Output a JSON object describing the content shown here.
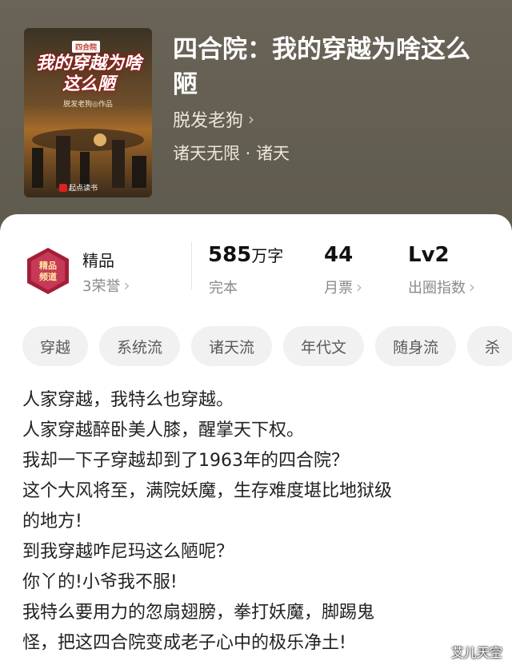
{
  "book": {
    "title": "四合院：我的穿越为啥这么陋",
    "author": "脱发老狗",
    "category": "诸天无限 · 诸天"
  },
  "cover": {
    "tag": "四合院",
    "title": "我的穿越为啥这么陋",
    "author_line": "脱发老狗◎作品",
    "publisher": "起点读书"
  },
  "stats": {
    "quality": {
      "label": "精品",
      "sub": "3荣誉"
    },
    "badge_text": "精品频道",
    "words": {
      "value": "585",
      "unit": "万字",
      "sub": "完本"
    },
    "votes": {
      "value": "44",
      "sub": "月票"
    },
    "level": {
      "value": "Lv2",
      "sub": "出圈指数"
    }
  },
  "tags": [
    "穿越",
    "系统流",
    "诸天流",
    "年代文",
    "随身流",
    "杀"
  ],
  "description": [
    "人家穿越，我特么也穿越。",
    "人家穿越醉卧美人膝，醒掌天下权。",
    "我却一下子穿越却到了1963年的四合院？",
    "这个大风将至，满院妖魔，生存难度堪比地狱级",
    "的地方!",
    "到我穿越咋尼玛这么陋呢？",
    "你丫的!小爷我不服!",
    "我特么要用力的忽扇翅膀，拳打妖魔，脚踢鬼",
    "怪，把这四合院变成老子心中的极乐净土!"
  ],
  "watermark": "艾儿天空",
  "icons": [
    "chevron-right-icon",
    "badge-icon"
  ]
}
